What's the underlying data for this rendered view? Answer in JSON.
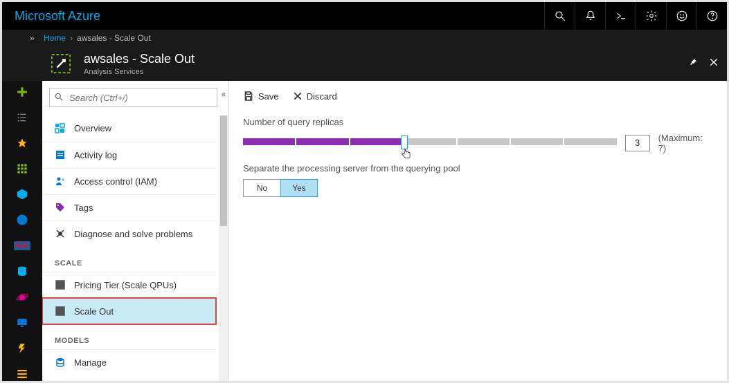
{
  "brand": "Microsoft Azure",
  "breadcrumb": {
    "home": "Home",
    "current": "awsales - Scale Out"
  },
  "header": {
    "title": "awsales - Scale Out",
    "subtitle": "Analysis Services"
  },
  "search": {
    "placeholder": "Search (Ctrl+/)"
  },
  "sidebar": {
    "items": [
      {
        "label": "Overview"
      },
      {
        "label": "Activity log"
      },
      {
        "label": "Access control (IAM)"
      },
      {
        "label": "Tags"
      },
      {
        "label": "Diagnose and solve problems"
      }
    ],
    "groups": [
      {
        "label": "SCALE",
        "items": [
          {
            "label": "Pricing Tier (Scale QPUs)"
          },
          {
            "label": "Scale Out"
          }
        ]
      },
      {
        "label": "MODELS",
        "items": [
          {
            "label": "Manage"
          }
        ]
      }
    ]
  },
  "toolbar": {
    "save": "Save",
    "discard": "Discard"
  },
  "form": {
    "replicas_label": "Number of query replicas",
    "replicas_value": "3",
    "replicas_max_label": "(Maximum: 7)",
    "separate_label": "Separate the processing server from the querying pool",
    "no": "No",
    "yes": "Yes"
  }
}
